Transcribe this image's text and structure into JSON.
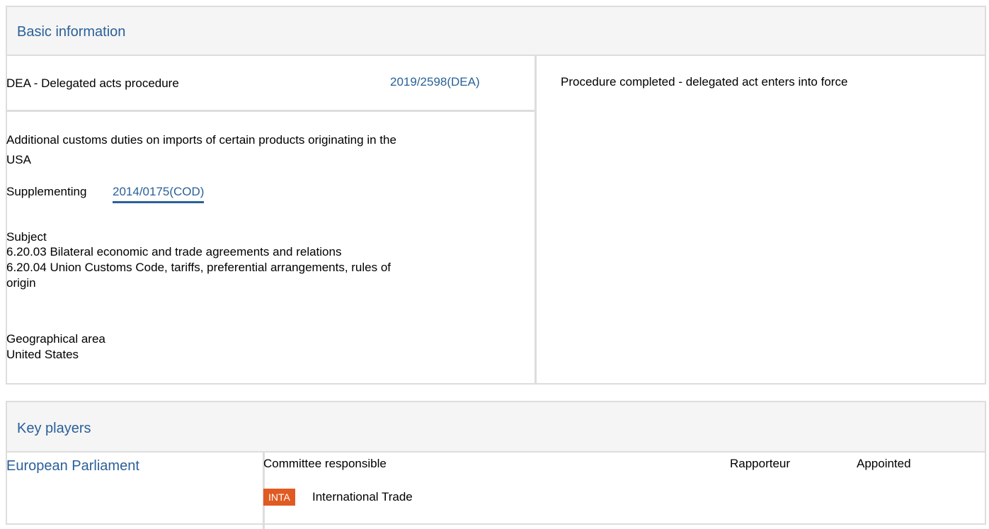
{
  "basic_information": {
    "title": "Basic information",
    "procedure_type": "DEA - Delegated acts procedure",
    "procedure_reference": "2019/2598(DEA)",
    "status": "Procedure completed - delegated act enters into force",
    "description_line1": "Additional customs duties on imports of certain products originating in the",
    "description_line2": "USA",
    "supplementing_label": "Supplementing",
    "supplementing_ref": "2014/0175(COD)",
    "subject_label": "Subject",
    "subject_items": [
      "6.20.03 Bilateral economic and trade agreements and relations",
      "6.20.04 Union Customs Code, tariffs, preferential arrangements, rules of",
      "origin"
    ],
    "geo_label": "Geographical area",
    "geo_value": "United States"
  },
  "key_players": {
    "title": "Key players",
    "institution": "European Parliament",
    "columns": {
      "committee": "Committee responsible",
      "rapporteur": "Rapporteur",
      "appointed": "Appointed"
    },
    "committee": {
      "code": "INTA",
      "name": "International Trade",
      "badge_color": "#e05a22"
    }
  }
}
